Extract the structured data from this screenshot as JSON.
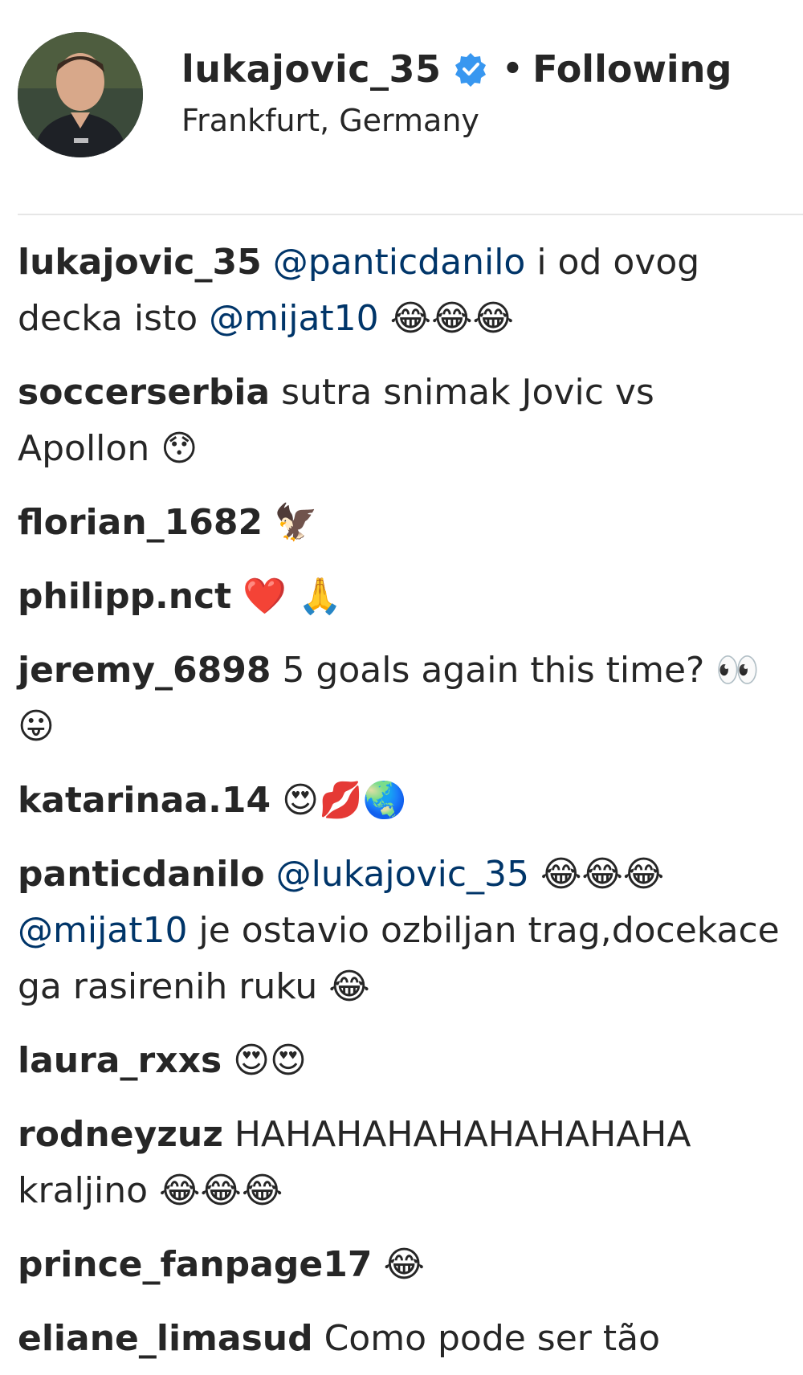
{
  "post_header": {
    "username": "lukajovic_35",
    "separator": "•",
    "follow_label": "Following",
    "location": "Frankfurt, Germany"
  },
  "comments": [
    {
      "user": "lukajovic_35",
      "parts": [
        {
          "t": " "
        },
        {
          "m": "@panticdanilo"
        },
        {
          "t": " i od ovog decka isto "
        },
        {
          "m": "@mijat10"
        },
        {
          "t": " 😂😂😂"
        }
      ]
    },
    {
      "user": "soccerserbia",
      "parts": [
        {
          "t": " sutra snimak Jovic vs Apollon 😯"
        }
      ]
    },
    {
      "user": "florian_1682",
      "parts": [
        {
          "t": " 🦅"
        }
      ]
    },
    {
      "user": "philipp.nct",
      "parts": [
        {
          "t": " ❤️ 🙏"
        }
      ]
    },
    {
      "user": "jeremy_6898",
      "parts": [
        {
          "t": " 5 goals again this time? 👀😛"
        }
      ]
    },
    {
      "user": "katarinaa.14",
      "parts": [
        {
          "t": " 😍💋🌏"
        }
      ]
    },
    {
      "user": "panticdanilo",
      "parts": [
        {
          "t": " "
        },
        {
          "m": "@lukajovic_35"
        },
        {
          "t": " 😂😂😂 "
        },
        {
          "m": "@mijat10"
        },
        {
          "t": " je ostavio ozbiljan trag,docekace ga rasirenih ruku 😂"
        }
      ]
    },
    {
      "user": "laura_rxxs",
      "parts": [
        {
          "t": " 😍😍"
        }
      ]
    },
    {
      "user": "rodneyzuz",
      "parts": [
        {
          "t": " HAHAHAHAHAHAHAHAHA kraljino 😂😂😂"
        }
      ]
    },
    {
      "user": "prince_fanpage17",
      "parts": [
        {
          "t": " 😂"
        }
      ]
    },
    {
      "user": "eliane_limasud",
      "parts": [
        {
          "t": " Como pode ser tão"
        }
      ]
    }
  ],
  "colors": {
    "text": "#262626",
    "mention": "#003569",
    "verified_badge": "#3897f0",
    "divider": "#e6e6e6"
  },
  "icons": {
    "verified": "verified-badge-icon",
    "avatar": "profile-photo"
  }
}
